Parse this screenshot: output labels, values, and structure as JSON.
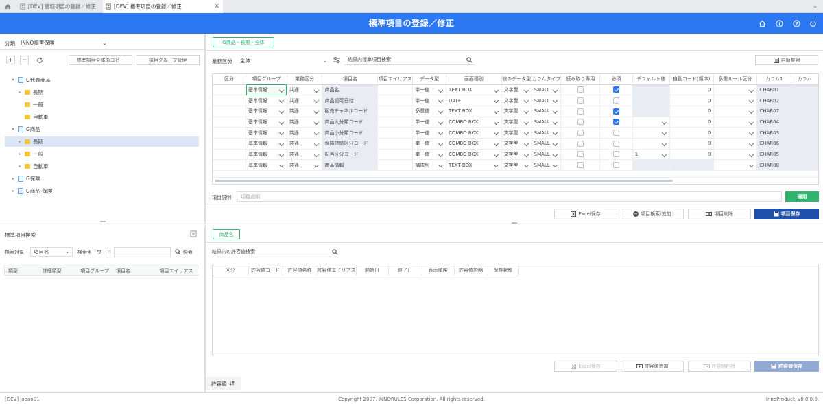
{
  "tabs": [
    {
      "label": "[DEV] 管理項目の登録／修正"
    },
    {
      "label": "[DEV] 標準項目の登録／修正"
    }
  ],
  "header": {
    "title": "標準項目の登録／修正"
  },
  "left": {
    "category_label": "分類",
    "category_value": "INNO損害保険",
    "copy_button": "標準項目全体のコピー",
    "group_button": "項目グループ管理",
    "tree": [
      {
        "label": "G代表商品",
        "level": 0,
        "type": "doc",
        "expanded": true
      },
      {
        "label": "長期",
        "level": 1,
        "type": "folder",
        "expanded": false
      },
      {
        "label": "一般",
        "level": 1,
        "type": "folder",
        "leaf": true
      },
      {
        "label": "自動車",
        "level": 1,
        "type": "folder",
        "leaf": true
      },
      {
        "label": "G商品",
        "level": 0,
        "type": "doc",
        "expanded": true
      },
      {
        "label": "長期",
        "level": 1,
        "type": "folder",
        "expanded": false,
        "selected": true
      },
      {
        "label": "一般",
        "level": 1,
        "type": "folder",
        "expanded": false
      },
      {
        "label": "自動車",
        "level": 1,
        "type": "folder",
        "expanded": false
      },
      {
        "label": "G保険",
        "level": 0,
        "type": "doc",
        "expanded": false
      },
      {
        "label": "G商品-保険",
        "level": 0,
        "type": "doc",
        "expanded": false
      }
    ]
  },
  "search": {
    "title": "標準項目検索",
    "target_label": "検索対象",
    "target_value": "項目名",
    "keyword_label": "検索キーワード",
    "lookup_button": "照会",
    "columns": [
      "類型",
      "詳細類型",
      "項目グループ",
      "項目名",
      "項目エイリアス"
    ]
  },
  "main": {
    "context_tag": "G商品 - 長期 - 全体",
    "biz_label": "業務区分",
    "biz_value": "全体",
    "result_search_label": "結果内標準項目検索",
    "auto_sort_button": "自動整列",
    "columns": [
      "区分",
      "項目グループ",
      "業務区分",
      "項目名",
      "項目エイリアス",
      "データ型",
      "画面種別",
      "値のデータ型",
      "カラムタイプ",
      "読み取り専用",
      "必須",
      "デフォルト値",
      "自動コード(順序)",
      "多重ルール区分",
      "カラム1",
      "カラム"
    ],
    "rows": [
      {
        "group": "基本情報",
        "biz": "共通",
        "name": "商品名",
        "dtype": "単一値",
        "screen": "TEXT BOX",
        "vtype": "文字型",
        "ctype": "SMALL",
        "ro": false,
        "req": true,
        "def": "",
        "def_dd": false,
        "auto": "0",
        "col": "CHAR01"
      },
      {
        "group": "基本情報",
        "biz": "共通",
        "name": "商品認可日付",
        "dtype": "単一値",
        "screen": "DATE",
        "vtype": "文字型",
        "ctype": "SMALL",
        "ro": false,
        "req": false,
        "def": "",
        "def_dd": false,
        "auto": "0",
        "col": "CHAR02"
      },
      {
        "group": "基本情報",
        "biz": "共通",
        "name": "販売チャネルコード",
        "dtype": "多重値",
        "screen": "TEXT BOX",
        "vtype": "文字型",
        "ctype": "SMALL",
        "ro": false,
        "req": true,
        "def": "",
        "def_dd": false,
        "auto": "0",
        "col": "CHAR07"
      },
      {
        "group": "基本情報",
        "biz": "共通",
        "name": "商品大分類コード",
        "dtype": "単一値",
        "screen": "COMBO BOX",
        "vtype": "文字型",
        "ctype": "SMALL",
        "ro": false,
        "req": true,
        "def": "",
        "def_dd": true,
        "auto": "0",
        "col": "CHAR04"
      },
      {
        "group": "基本情報",
        "biz": "共通",
        "name": "商品小分類コード",
        "dtype": "単一値",
        "screen": "COMBO BOX",
        "vtype": "文字型",
        "ctype": "SMALL",
        "ro": false,
        "req": false,
        "def": "",
        "def_dd": true,
        "auto": "0",
        "col": "CHAR03"
      },
      {
        "group": "基本情報",
        "biz": "共通",
        "name": "保障旅盛区分コード",
        "dtype": "単一値",
        "screen": "COMBO BOX",
        "vtype": "文字型",
        "ctype": "SMALL",
        "ro": false,
        "req": false,
        "def": "",
        "def_dd": true,
        "auto": "0",
        "col": "CHAR06"
      },
      {
        "group": "基本情報",
        "biz": "共通",
        "name": "配当区分コード",
        "dtype": "単一値",
        "screen": "COMBO BOX",
        "vtype": "文字型",
        "ctype": "SMALL",
        "ro": false,
        "req": false,
        "def": "1",
        "def_dd": true,
        "auto": "0",
        "col": "CHAR05"
      },
      {
        "group": "基本情報",
        "biz": "共通",
        "name": "商品情報",
        "dtype": "構成型",
        "screen": "TEXT BOX",
        "vtype": "文字型",
        "ctype": "SMALL",
        "ro": false,
        "req": false,
        "def": "",
        "def_dd": false,
        "auto": "",
        "col": "CHAR08"
      }
    ],
    "desc_label": "項目説明",
    "desc_placeholder": "項目説明",
    "apply_button": "適用",
    "excel_button": "Excel保存",
    "add_button": "項目検索/追加",
    "delete_button": "項目削除",
    "save_button": "項目保存"
  },
  "lower": {
    "tag": "商品名",
    "search_label": "結果内の許容値検索",
    "columns": [
      "区分",
      "許容値コード",
      "許容値名称",
      "許容値エイリアス",
      "開始日",
      "終了日",
      "表示順序",
      "許容値説明",
      "保存状態"
    ],
    "excel_button": "Excel保存",
    "add_button": "許容値追加",
    "delete_button": "許容値削除",
    "save_button": "許容値保存",
    "footer_tab": "許容値"
  },
  "footer": {
    "left": "[DEV] japan01",
    "center": "Copyright 2007. INNORULES Corporation. All rights reserved.",
    "right": "InnoProduct, v8.0.0.0."
  },
  "colors": {
    "header": "#2b78f2",
    "accent_green": "#2fb36d",
    "save_blue": "#1f4fa8"
  }
}
